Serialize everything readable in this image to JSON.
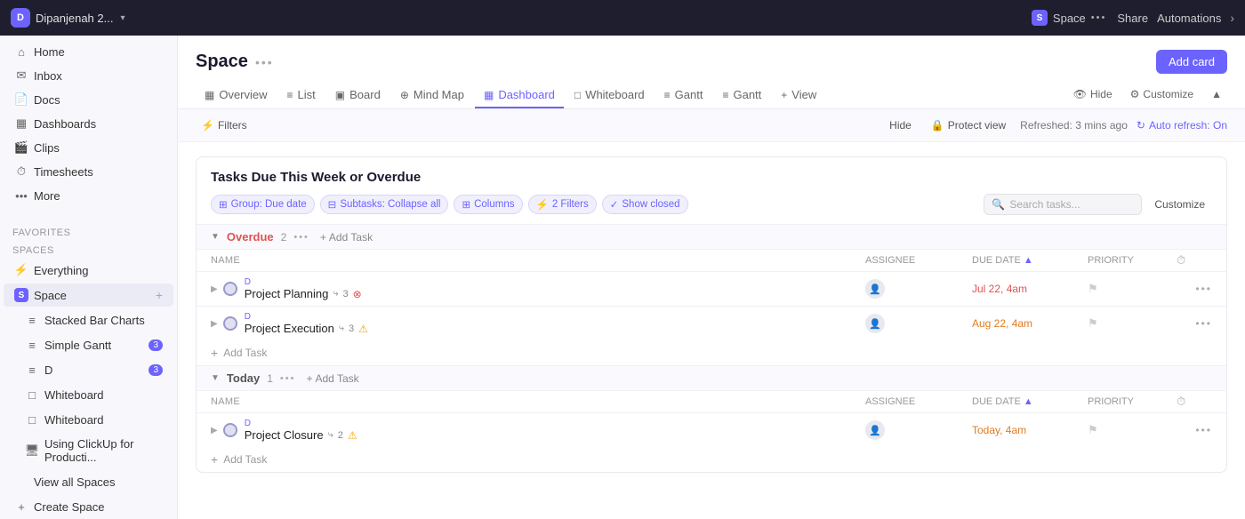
{
  "topbar": {
    "workspace_initial": "D",
    "workspace_name": "Dipanjenah 2...",
    "space_initial": "S",
    "space_name": "Space",
    "space_dots": "•••",
    "share_label": "Share",
    "automations_label": "Automations"
  },
  "sidebar": {
    "nav_items": [
      {
        "id": "home",
        "icon": "⌂",
        "label": "Home"
      },
      {
        "id": "inbox",
        "icon": "✉",
        "label": "Inbox"
      },
      {
        "id": "docs",
        "icon": "📄",
        "label": "Docs"
      },
      {
        "id": "dashboards",
        "icon": "▦",
        "label": "Dashboards"
      },
      {
        "id": "clips",
        "icon": "🎬",
        "label": "Clips"
      },
      {
        "id": "timesheets",
        "icon": "⏱",
        "label": "Timesheets"
      },
      {
        "id": "more",
        "icon": "•••",
        "label": "More"
      }
    ],
    "favorites_label": "Favorites",
    "spaces_label": "Spaces",
    "spaces_items": [
      {
        "id": "everything",
        "icon": "⚡",
        "label": "Everything"
      },
      {
        "id": "space",
        "icon": "S",
        "label": "Space",
        "active": true
      },
      {
        "id": "stacked-bar-charts",
        "icon": "≡",
        "label": "Stacked Bar Charts",
        "indent": 1
      },
      {
        "id": "simple-gantt",
        "icon": "≡",
        "label": "Simple Gantt",
        "indent": 1,
        "badge": "3"
      },
      {
        "id": "d",
        "icon": "≡",
        "label": "D",
        "indent": 1,
        "badge": "3"
      },
      {
        "id": "whiteboard1",
        "icon": "□",
        "label": "Whiteboard",
        "indent": 1
      },
      {
        "id": "whiteboard2",
        "icon": "□",
        "label": "Whiteboard",
        "indent": 1
      },
      {
        "id": "using-clickup",
        "icon": "🖥",
        "label": "Using ClickUp for Producti...",
        "indent": 1
      },
      {
        "id": "view-all-spaces",
        "icon": "",
        "label": "View all Spaces"
      },
      {
        "id": "create-space",
        "icon": "+",
        "label": "Create Space"
      }
    ]
  },
  "content": {
    "title": "Space",
    "title_dots": "•••",
    "add_card_label": "Add card",
    "tabs": [
      {
        "id": "overview",
        "icon": "▦",
        "label": "Overview"
      },
      {
        "id": "list",
        "icon": "≡",
        "label": "List"
      },
      {
        "id": "board",
        "icon": "▣",
        "label": "Board"
      },
      {
        "id": "mind-map",
        "icon": "⊕",
        "label": "Mind Map"
      },
      {
        "id": "dashboard",
        "icon": "▦",
        "label": "Dashboard",
        "active": true
      },
      {
        "id": "whiteboard",
        "icon": "□",
        "label": "Whiteboard"
      },
      {
        "id": "gantt1",
        "icon": "≡",
        "label": "Gantt"
      },
      {
        "id": "gantt2",
        "icon": "≡",
        "label": "Gantt"
      },
      {
        "id": "view",
        "icon": "+",
        "label": "View"
      }
    ],
    "tab_actions": {
      "hide": "Hide",
      "customize": "Customize"
    }
  },
  "filter_bar": {
    "filters_label": "Filters",
    "hide_label": "Hide",
    "protect_view_label": "Protect view",
    "refreshed_label": "Refreshed: 3 mins ago",
    "auto_refresh_label": "Auto refresh: On"
  },
  "widget": {
    "title": "Tasks Due This Week or Overdue",
    "toolbar": {
      "group_label": "Group: Due date",
      "subtasks_label": "Subtasks: Collapse all",
      "columns_label": "Columns",
      "filters_label": "2 Filters",
      "show_closed_label": "Show closed",
      "search_placeholder": "Search tasks...",
      "customize_label": "Customize"
    },
    "groups": [
      {
        "id": "overdue",
        "name": "Overdue",
        "count": "2",
        "cols": [
          "Name",
          "Assignee",
          "Due date",
          "Priority"
        ],
        "tasks": [
          {
            "id": "t1",
            "d_label": "D",
            "name": "Project Planning",
            "subtask_icon": "⤷",
            "subtask_count": "3",
            "warn_type": "error",
            "warn_icon": "⊗",
            "due": "Jul 22, 4am",
            "due_class": "overdue"
          },
          {
            "id": "t2",
            "d_label": "D",
            "name": "Project Execution",
            "subtask_icon": "⤷",
            "subtask_count": "3",
            "warn_type": "warning",
            "warn_icon": "⚠",
            "due": "Aug 22, 4am",
            "due_class": "warning"
          }
        ],
        "add_task_label": "Add Task"
      },
      {
        "id": "today",
        "name": "Today",
        "count": "1",
        "cols": [
          "Name",
          "Assignee",
          "Due date",
          "Priority"
        ],
        "tasks": [
          {
            "id": "t3",
            "d_label": "D",
            "name": "Project Closure",
            "subtask_icon": "⤷",
            "subtask_count": "2",
            "warn_type": "warning",
            "warn_icon": "⚠",
            "due": "Today, 4am",
            "due_class": "today-color"
          }
        ],
        "add_task_label": "Add Task"
      }
    ]
  }
}
